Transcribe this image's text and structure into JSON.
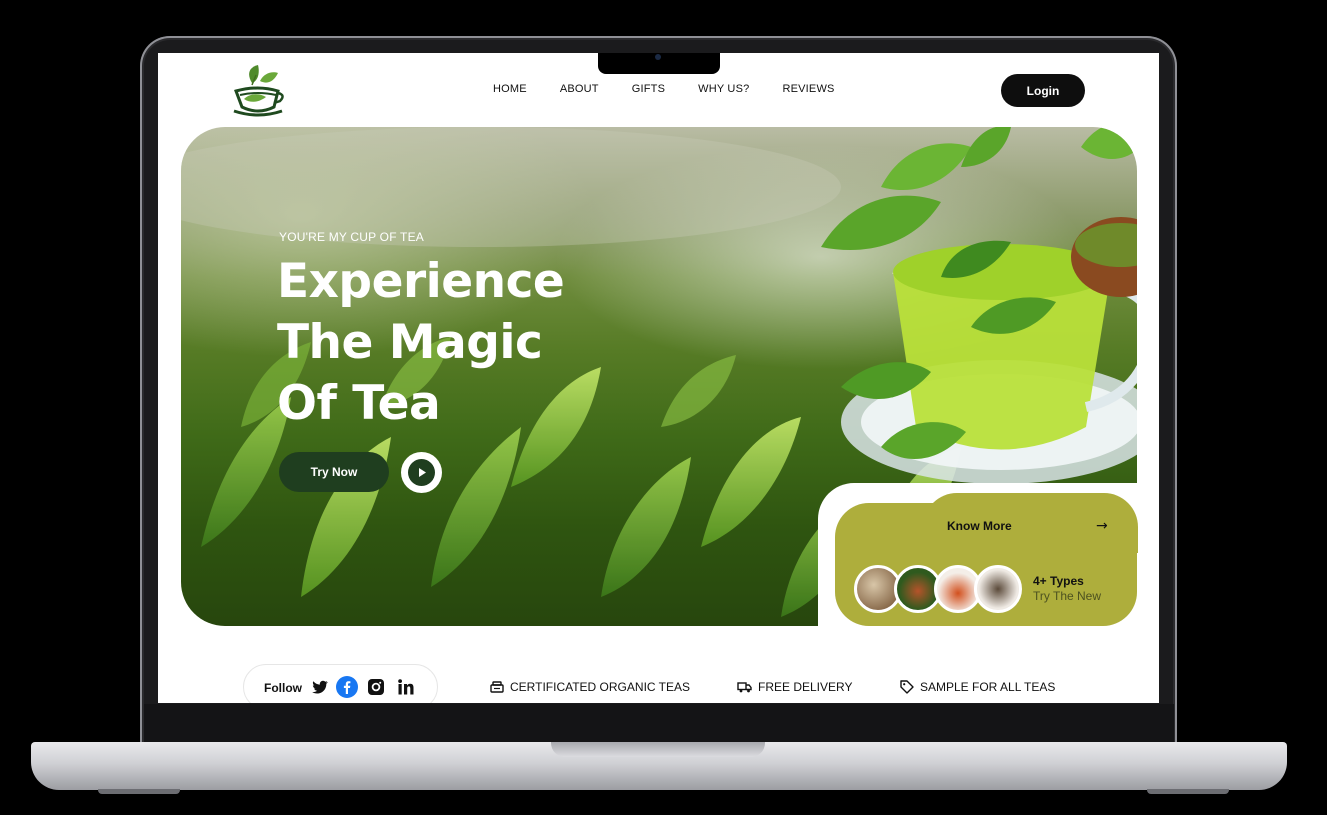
{
  "nav": {
    "items": [
      "HOME",
      "ABOUT",
      "GIFTS",
      "WHY US?",
      "REVIEWS"
    ],
    "login_label": "Login"
  },
  "hero": {
    "eyebrow": "YOU'RE MY CUP OF TEA",
    "title_lines": [
      "Experience",
      "The Magic",
      "Of Tea"
    ],
    "cta_label": "Try Now"
  },
  "card": {
    "know_more": "Know More",
    "types_title": "4+ Types",
    "types_subtitle": "Try The New"
  },
  "follow": {
    "label": "Follow",
    "icons": [
      "twitter-icon",
      "facebook-icon",
      "instagram-icon",
      "linkedin-icon"
    ]
  },
  "features": [
    {
      "icon": "certificate-icon",
      "label": "CERTIFICATED ORGANIC TEAS"
    },
    {
      "icon": "truck-icon",
      "label": "FREE DELIVERY"
    },
    {
      "icon": "tag-icon",
      "label": "SAMPLE FOR ALL TEAS"
    }
  ],
  "colors": {
    "primary_dark_green": "#1f3e1f",
    "card_olive": "#aeae3c",
    "login_bg": "#0e0e0e",
    "facebook_blue": "#1877f2"
  }
}
